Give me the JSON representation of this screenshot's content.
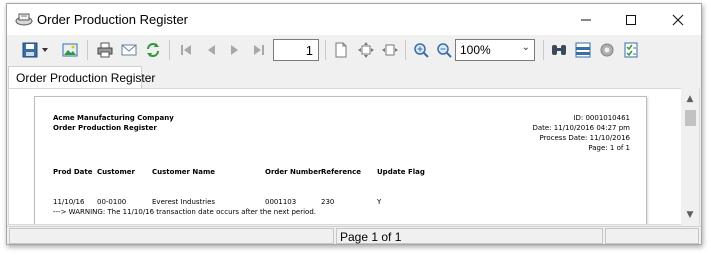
{
  "window": {
    "title": "Order Production Register",
    "controls": {
      "minimize": "—",
      "maximize": "☐",
      "close": "✕"
    }
  },
  "toolbar": {
    "page_number": "1",
    "zoom": "100%",
    "icons": [
      "save-icon",
      "dropdown-arrow-icon",
      "export-image-icon",
      "print-icon",
      "email-icon",
      "refresh-icon",
      "first-page-icon",
      "previous-page-icon",
      "next-page-icon",
      "last-page-icon",
      "page-setup-icon",
      "fit-page-icon",
      "fit-width-icon",
      "zoom-in-icon",
      "zoom-out-icon",
      "find-icon",
      "group-tree-icon",
      "settings-icon",
      "checklist-icon"
    ]
  },
  "tab": {
    "label": "Order Production Register"
  },
  "report": {
    "company": "Acme Manufacturing Company",
    "title": "Order Production Register",
    "id_line": "ID: 0001010461",
    "date_line": "Date: 11/10/2016 04:27 pm",
    "process_date_line": "Process Date: 11/10/2016",
    "page_line": "Page: 1 of 1",
    "columns": [
      "Prod Date",
      "Customer",
      "Customer Name",
      "Order Number",
      "Reference",
      "Update Flag"
    ],
    "rows": [
      [
        "11/10/16",
        "00-0100",
        "Everest Industries",
        "0001103",
        "230",
        "Y"
      ]
    ],
    "warning": "---> WARNING: The 11/10/16 transaction date occurs after the next period."
  },
  "status": {
    "page_text": "Page 1 of 1"
  },
  "colors": {
    "window_bg": "#f0f0f0",
    "accent_green": "#2e9a3a",
    "icon_blue": "#3a6ea5"
  }
}
